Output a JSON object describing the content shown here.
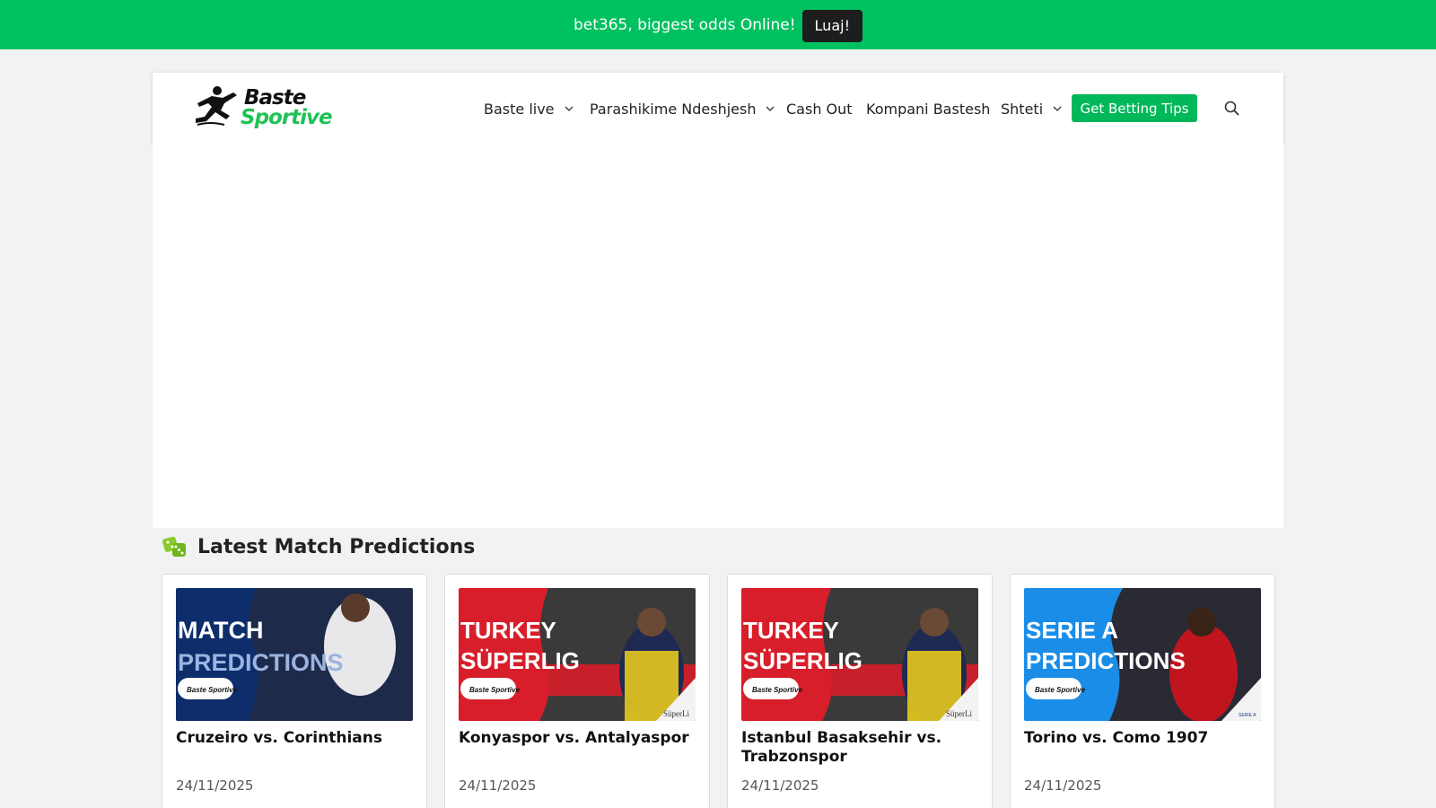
{
  "promo": {
    "text": "bet365, biggest odds Online!",
    "button": "Luaj!"
  },
  "header": {
    "logo": {
      "line1": "Baste",
      "line2": "Sportive"
    },
    "nav": [
      {
        "label": "Baste live",
        "has_dropdown": true
      },
      {
        "label": "Parashikime Ndeshjesh",
        "has_dropdown": true
      },
      {
        "label": "Cash Out",
        "has_dropdown": false
      },
      {
        "label": "Kompani Bastesh",
        "has_dropdown": false
      },
      {
        "label": "Shteti",
        "has_dropdown": true
      }
    ],
    "cta": "Get Betting Tips",
    "search_icon": "search-icon"
  },
  "section": {
    "title": "Latest Match Predictions",
    "icon": "dice-icon"
  },
  "colors": {
    "brand_green": "#00c160",
    "cta_green": "#00b85a",
    "dark": "#1d1d1d"
  },
  "cards": [
    {
      "title": "Cruzeiro vs. Corinthians",
      "date": "24/11/2025",
      "thumb": {
        "line1": "MATCH",
        "line2": "PREDICTIONS",
        "badge": "",
        "bg": "#0d2d6b",
        "logo": "Baste Sportive"
      }
    },
    {
      "title": "Konyaspor vs. Antalyaspor",
      "date": "24/11/2025",
      "thumb": {
        "line1": "TURKEY",
        "line2": "SÜPERLIG",
        "badge": "SüperLi",
        "bg": "#d81e2a",
        "logo": "Baste Sportive"
      }
    },
    {
      "title": "Istanbul Basaksehir vs. Trabzonspor",
      "date": "24/11/2025",
      "thumb": {
        "line1": "TURKEY",
        "line2": "SÜPERLIG",
        "badge": "SüperLi",
        "bg": "#d81e2a",
        "logo": "Baste Sportive"
      }
    },
    {
      "title": "Torino vs. Como 1907",
      "date": "24/11/2025",
      "thumb": {
        "line1": "SERIE A",
        "line2": "PREDICTIONS",
        "badge": "SERIE A",
        "bg": "#1a8de8",
        "logo": "Baste Sportive"
      }
    }
  ]
}
